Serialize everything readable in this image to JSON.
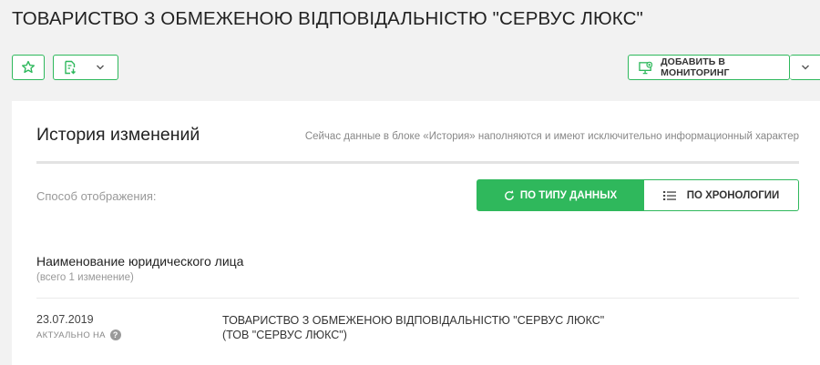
{
  "company": {
    "title": "ТОВАРИСТВО З ОБМЕЖЕНОЮ ВІДПОВІДАЛЬНІСТЮ \"СЕРВУС ЛЮКС\""
  },
  "toolbar": {
    "star_icon": "star-icon",
    "export_icon": "document-export-icon",
    "monitor_icon": "monitor-plus-icon",
    "monitor_label": "ДОБАВИТЬ В МОНИТОРИНГ",
    "accent_color": "#2eb85c"
  },
  "history": {
    "title": "История изменений",
    "note": "Сейчас данные в блоке «История» наполняются и имеют исключительно информационный характер",
    "display_label": "Способ отображения:",
    "toggle": {
      "by_type": "ПО ТИПУ ДАННЫХ",
      "by_chronology": "ПО ХРОНОЛОГИИ",
      "selected": "by_type"
    },
    "group": {
      "title": "Наименование юридического лица",
      "count": "(всего 1 изменение)",
      "rows": [
        {
          "date": "23.07.2019",
          "actual_label": "АКТУАЛЬНО НА",
          "value_line1": "ТОВАРИСТВО З ОБМЕЖЕНОЮ ВІДПОВІДАЛЬНІСТЮ \"СЕРВУС ЛЮКС\"",
          "value_line2": "(ТОВ \"СЕРВУС ЛЮКС\")"
        }
      ]
    }
  }
}
